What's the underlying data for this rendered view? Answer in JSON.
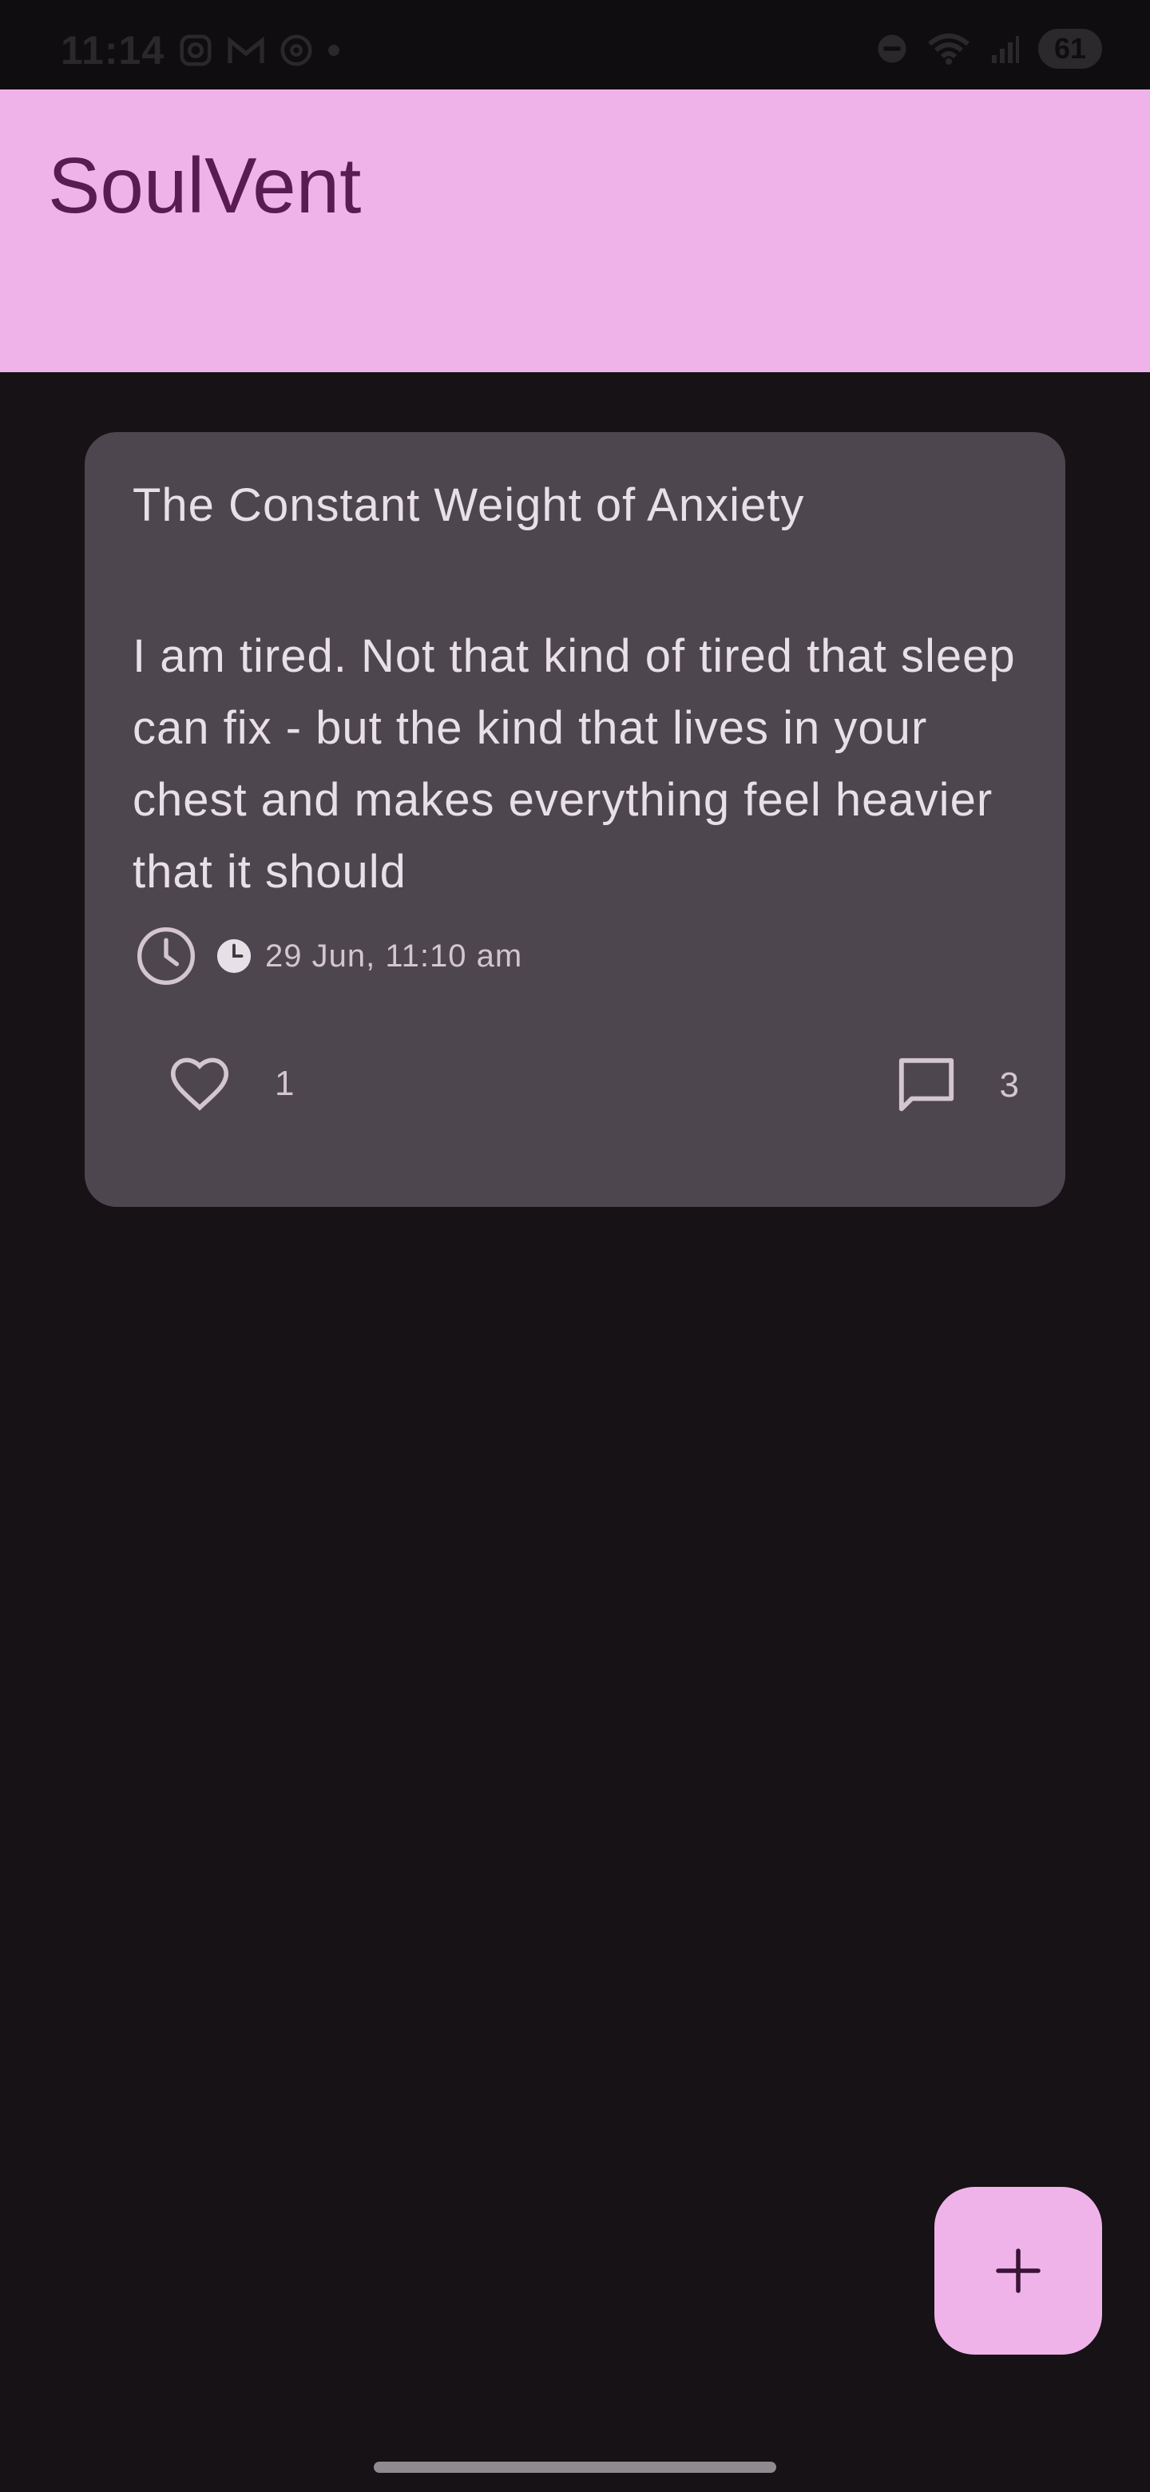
{
  "status_bar": {
    "time": "11:14",
    "battery": "61",
    "left_icons": [
      "instagram-icon",
      "gmail-icon",
      "threads-icon",
      "dot-icon"
    ],
    "right_icons": [
      "dnd-icon",
      "wifi-icon",
      "signal-icon",
      "battery-icon"
    ]
  },
  "app_bar": {
    "title": "SoulVent"
  },
  "post": {
    "title": "The Constant Weight of Anxiety",
    "body": "I am tired. Not that kind of tired that sleep can fix - but the kind that lives in your chest and makes everything feel heavier that it should",
    "timestamp": "29 Jun, 11:10 am",
    "likes": "1",
    "comments": "3"
  },
  "fab": {
    "icon": "plus-icon"
  },
  "colors": {
    "background": "#161216",
    "app_bar": "#efb3e9",
    "title": "#5a1b51",
    "card": "#4e464e",
    "text": "#e8e0e7"
  }
}
